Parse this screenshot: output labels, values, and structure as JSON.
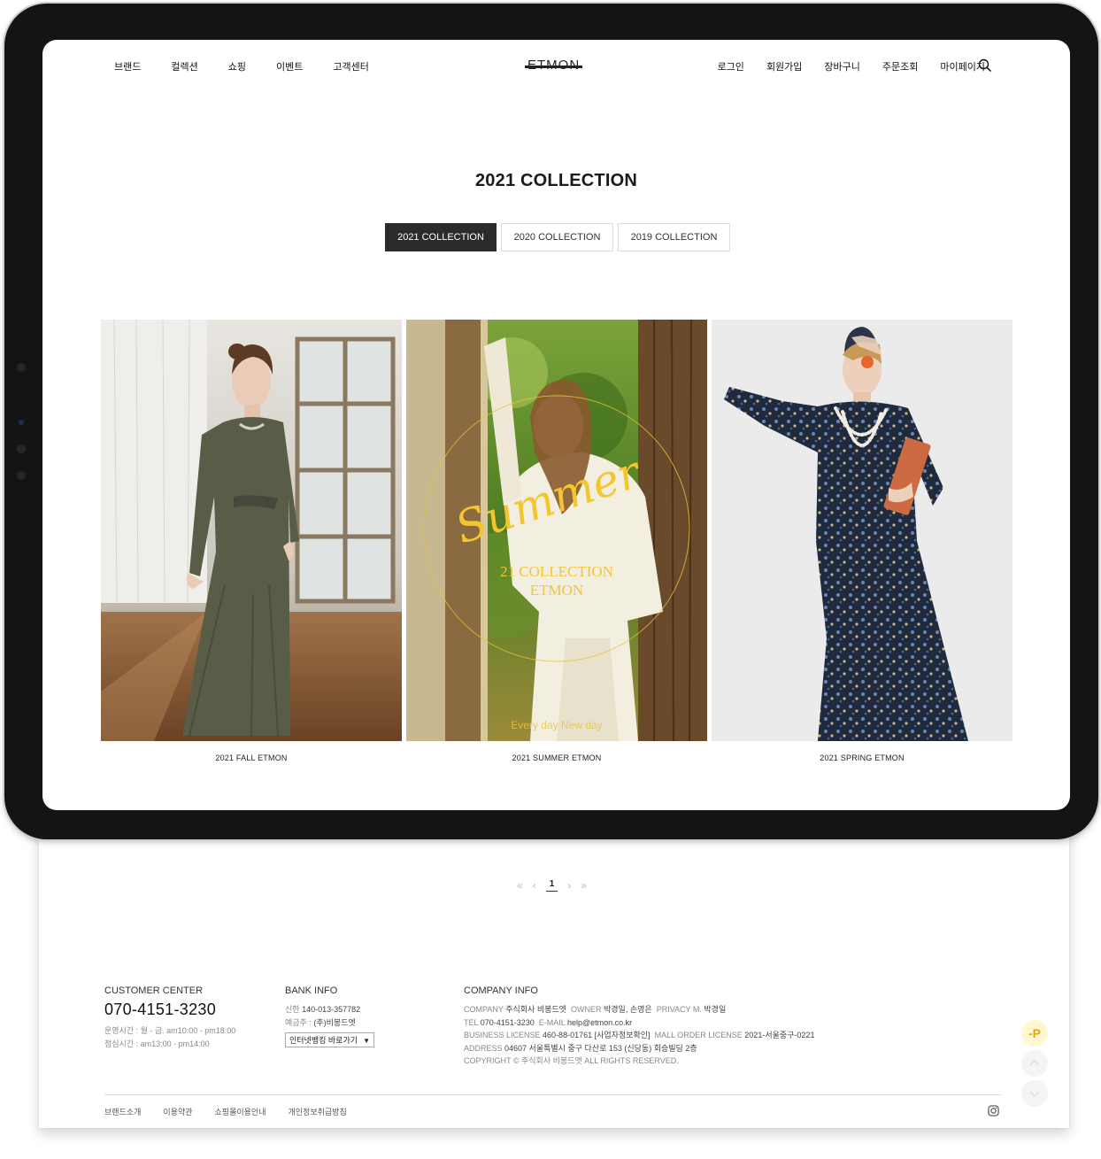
{
  "header": {
    "logo": "ETMON",
    "nav_left": [
      "브랜드",
      "컬렉션",
      "쇼핑",
      "이벤트",
      "고객센터"
    ],
    "nav_right": [
      "로그인",
      "회원가입",
      "장바구니",
      "주문조회",
      "마이페이지"
    ],
    "search_icon": "search-icon"
  },
  "main": {
    "title": "2021 COLLECTION",
    "tabs": [
      "2021 COLLECTION",
      "2020 COLLECTION",
      "2019 COLLECTION"
    ],
    "active_tab": "2021 COLLECTION",
    "cards": [
      {
        "caption": "2021 FALL ETMON"
      },
      {
        "caption": "2021 SUMMER ETMON",
        "overlay_script": "Summer",
        "overlay_line1": "21 COLLECTION",
        "overlay_line2": "ETMON",
        "overlay_tagline": "Every day New day"
      },
      {
        "caption": "2021 SPRING ETMON"
      }
    ]
  },
  "pagination": {
    "first": "«",
    "prev": "‹",
    "current": "1",
    "next": "›",
    "last": "»"
  },
  "footer": {
    "customer_center": {
      "heading": "CUSTOMER CENTER",
      "phone": "070-4151-3230",
      "hours": "운영시간 : 월 - 금. am10:00 - pm18:00",
      "lunch": "점심시간 : am13:00 - pm14:00"
    },
    "bank_info": {
      "heading": "BANK INFO",
      "bank_label": "신한",
      "account": "140-013-357782",
      "holder_label": "예금주 :",
      "holder": "(주)비봉드엣",
      "select": "인터넷뱅킹 바로가기"
    },
    "company_info": {
      "heading": "COMPANY INFO",
      "company_label": "COMPANY",
      "company": "주식회사 비봉드엣",
      "owner_label": "OWNER",
      "owner": "박경일, 손영은",
      "privacy_label": "PRIVACY M.",
      "privacy": "박경일",
      "tel_label": "TEL",
      "tel": "070-4151-3230",
      "email_label": "E-MAIL",
      "email": "help@etmon.co.kr",
      "biz_label": "BUSINESS LICENSE",
      "biz": "460-88-01761 [사업자정보확인]",
      "mall_label": "MALL ORDER LICENSE",
      "mall": "2021-서울중구-0221",
      "address_label": "ADDRESS",
      "address": "04607 서울특별시 중구 다산로 153 (신당동) 회승빌딩 2층",
      "copyright": "COPYRIGHT © 주식회사 비봉드엣 ALL RIGHTS RESERVED."
    },
    "links": [
      "브랜드소개",
      "이용약관",
      "쇼핑몰이용안내",
      "개인정보취급방침"
    ],
    "instagram_icon": "instagram-icon"
  },
  "floating": {
    "point_label": "-P"
  }
}
